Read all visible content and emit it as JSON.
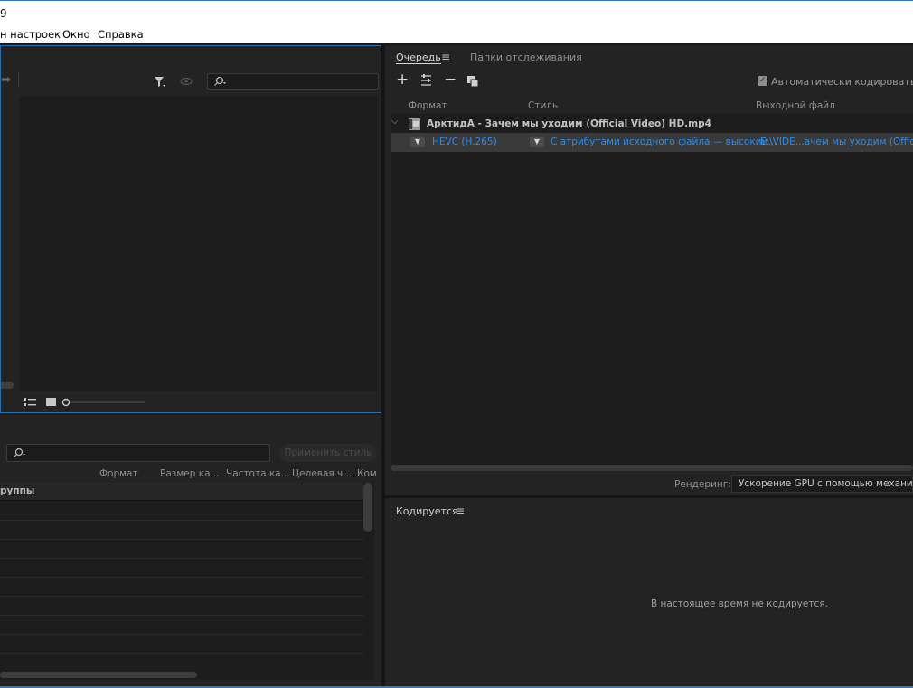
{
  "window": {
    "title_fragment": "9"
  },
  "menu": {
    "items": [
      "н настроек",
      "Окно",
      "Справка"
    ]
  },
  "media_browser": {
    "forward_arrow": "➡",
    "filter_icon": "funnel-icon",
    "eye_icon": "eye-icon"
  },
  "preset_browser": {
    "apply_button": "Применить стиль",
    "columns": [
      "Формат",
      "Размер ка...",
      "Частота ка...",
      "Целевая ч...",
      "Ком"
    ],
    "group_label": "руппы"
  },
  "queue": {
    "tab_active": "Очередь",
    "tab_inactive": "Папки отслеживания",
    "auto_encode_label": "Автоматически кодировать папки",
    "columns": {
      "format": "Формат",
      "preset": "Стиль",
      "output": "Выходной файл"
    },
    "item": {
      "source": "АрктидА - Зачем мы уходим (Official Video) HD.mp4",
      "format": "HEVC (H.265)",
      "preset": "С атрибутами исходного файла — высокий...",
      "output": "E:\\VIDE...ачем мы уходим (Official Video"
    },
    "renderer_label": "Рендеринг:",
    "renderer_value": "Ускорение GPU с помощью механизма"
  },
  "encoding": {
    "title": "Кодируется",
    "status": "В настоящее время не кодируется."
  },
  "colors": {
    "accent": "#2d8ceb",
    "focus_border": "#2a6fb0",
    "panel": "#232323"
  }
}
